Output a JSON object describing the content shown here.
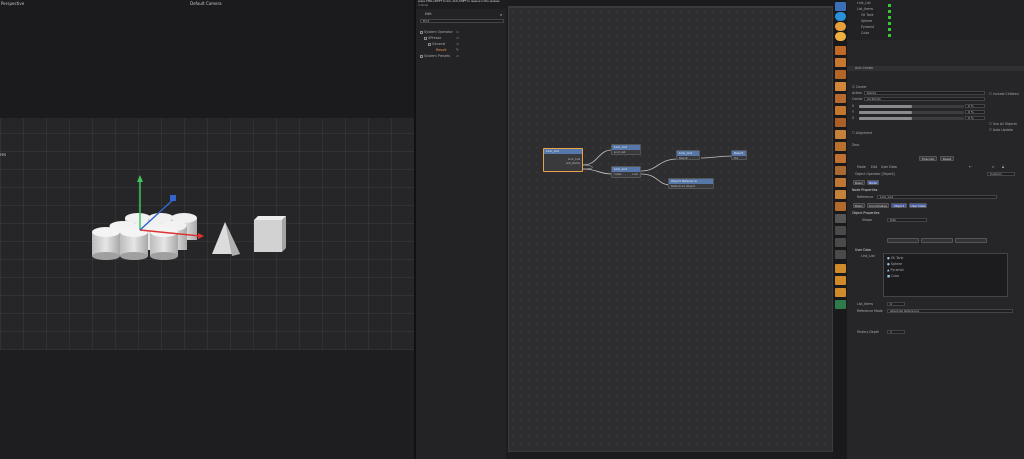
{
  "viewport": {
    "label": "Perspective",
    "camera": "Default Camera",
    "axis_label": "res"
  },
  "tooltip": {
    "line1": "press CTRL+SHIFT to link, ALT+SHIFT to reserve in the xpresso",
    "line2": "In Node"
  },
  "xpresso_manager": {
    "menu": "Edit",
    "search": "Find",
    "tree": [
      "System Operator",
      "XPresso",
      "General",
      "Result",
      "System Presets"
    ]
  },
  "canvas": {
    "title": "XPresso",
    "nodes": {
      "link_list_main": {
        "title": "Link_List",
        "ports": [
          "Link_List",
          "List_Items"
        ]
      },
      "link_list_a": {
        "title": "Link_List",
        "ports": [
          "Link List"
        ]
      },
      "link_list_b": {
        "title": "Link_List",
        "ports": [
          "Index",
          "Link"
        ]
      },
      "link_list_c": {
        "title": "Link_List",
        "ports": [
          "Result"
        ]
      },
      "result": {
        "title": "Result",
        "ports": [
          "Hit"
        ]
      },
      "object_reference": {
        "title": "Object Reference",
        "ports": [
          "Reference Object"
        ]
      }
    }
  },
  "objects_panel": {
    "items": [
      "Link_List",
      "List_Items",
      "Oil Tank",
      "Sphere",
      "Pyramid",
      "Cube"
    ]
  },
  "attributes": {
    "header": "Axis Center",
    "axis_center": {
      "center_checkbox": "Center",
      "include_children": "Include Children",
      "use_all_objects": "Use All Objects",
      "auto_update": "Auto Update",
      "action_label": "Action",
      "action_value": "Points",
      "center_label": "Center",
      "center_value": "All Points",
      "x_label": "X",
      "y_label": "Y",
      "z_label": "Z",
      "pct": "0 %",
      "align_label": "Alignment",
      "zero_label": "Zero",
      "execute": "Execute",
      "reset": "Reset"
    },
    "mode_menu": [
      "Mode",
      "Edit",
      "User Data"
    ],
    "object_operator": "Object Operator [Object]",
    "custom": "Custom",
    "tabs": [
      "Basic",
      "Node"
    ],
    "node_properties_title": "Node Properties",
    "reference_label": "Reference",
    "reference_value": "Link_List",
    "sub_tabs": [
      "Basic",
      "Coordinates",
      "Object",
      "User Data"
    ],
    "object_properties_title": "Object Properties",
    "shape_label": "Shape",
    "shape_value": "Oak",
    "user_data_title": "User Data",
    "link_list_label": "Link_List",
    "link_list_items": [
      "Oil Tank",
      "Sphere",
      "Pyramid",
      "Cube"
    ],
    "list_items_label": "List_Items",
    "list_items_value": "0",
    "reference_mode_label": "Reference Mode",
    "reference_mode_value": "Absolute Reference",
    "history_depth_label": "History Depth",
    "history_depth_value": "1"
  },
  "colors": {
    "accent_blue": "#4a5fa8",
    "node_header": "#5577aa",
    "node_orange": "#c27a3a",
    "wire": "#c0c0c0",
    "toggle_green": "#33cc33"
  }
}
